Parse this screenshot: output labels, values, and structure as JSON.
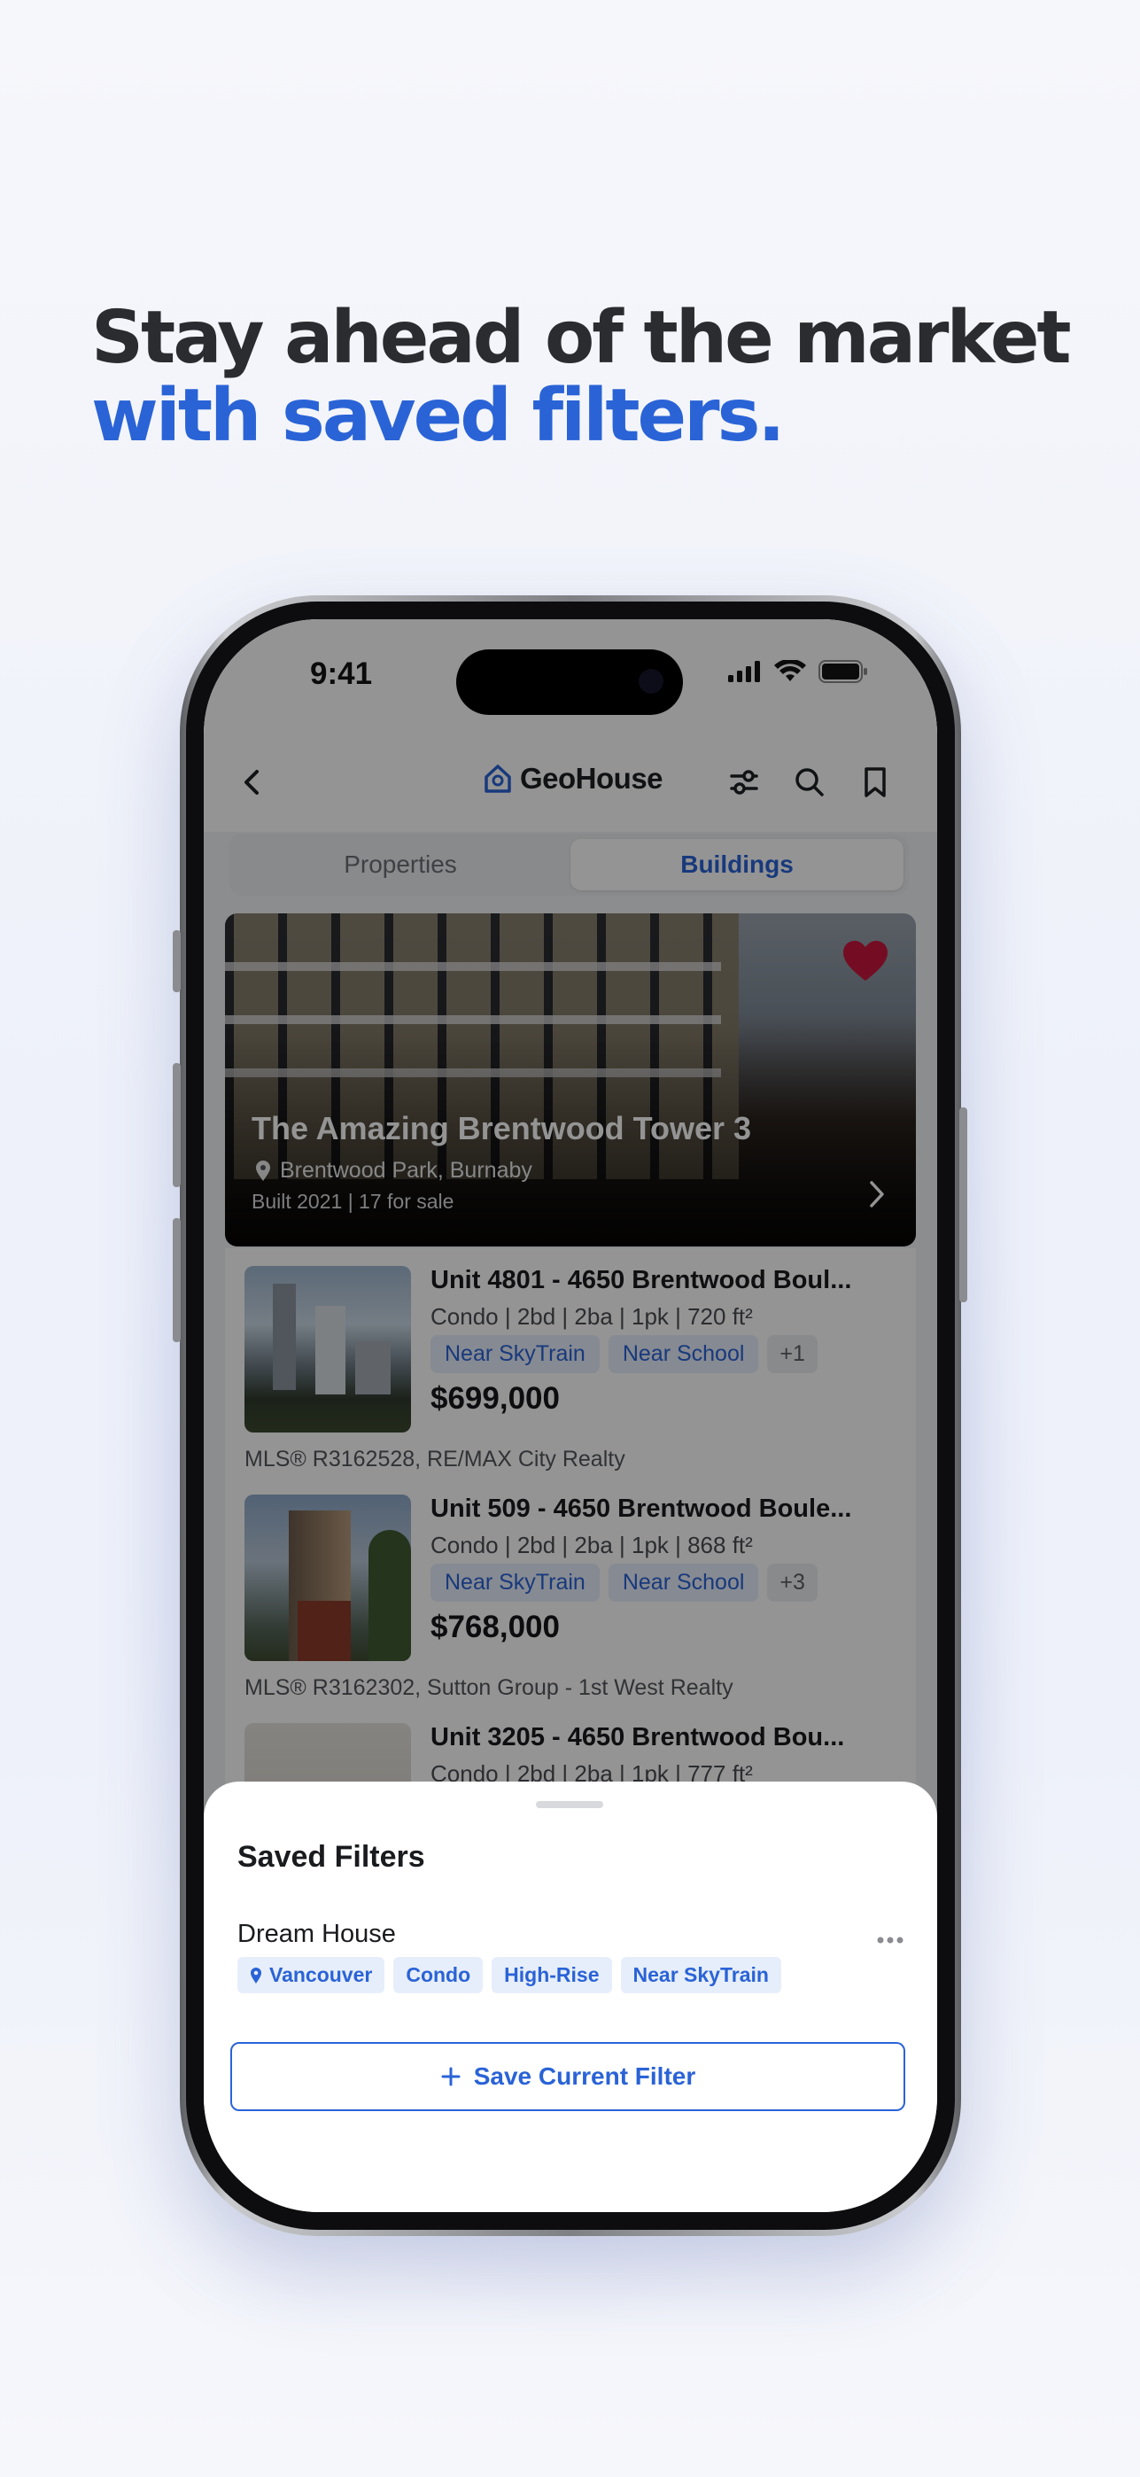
{
  "headline": {
    "line1": "Stay ahead of the market",
    "line2": "with saved filters."
  },
  "status_bar": {
    "time": "9:41"
  },
  "navbar": {
    "logo_text": "GeoHouse"
  },
  "tabs": [
    {
      "label": "Properties",
      "active": false
    },
    {
      "label": "Buildings",
      "active": true
    }
  ],
  "hero": {
    "title": "The Amazing Brentwood Tower 3",
    "location": "Brentwood Park, Burnaby",
    "meta": "Built 2021 | 17 for sale",
    "favorited": true
  },
  "listings": [
    {
      "title": "Unit 4801 - 4650 Brentwood Boul...",
      "details": "Condo | 2bd | 2ba | 1pk | 720 ft²",
      "tags": [
        "Near SkyTrain",
        "Near School"
      ],
      "more_tags": "+1",
      "price": "$699,000",
      "mls": "MLS® R3162528, RE/MAX City Realty"
    },
    {
      "title": "Unit 509 - 4650 Brentwood Boule...",
      "details": "Condo | 2bd | 2ba | 1pk | 868 ft²",
      "tags": [
        "Near SkyTrain",
        "Near School"
      ],
      "more_tags": "+3",
      "price": "$768,000",
      "mls": "MLS® R3162302, Sutton Group - 1st West Realty"
    },
    {
      "title": "Unit 3205 - 4650 Brentwood Bou...",
      "details": "Condo | 2bd | 2ba | 1pk | 777 ft²"
    }
  ],
  "sheet": {
    "title": "Saved Filters",
    "filters": [
      {
        "name": "Dream House",
        "chips": [
          "Vancouver",
          "Condo",
          "High-Rise",
          "Near SkyTrain"
        ]
      }
    ],
    "save_button_label": "Save Current Filter"
  },
  "colors": {
    "accent": "#2a63d6",
    "heart": "#c8173f",
    "headline_dark": "#2b2c30"
  },
  "icons": {
    "back": "chevron-left-icon",
    "filter": "sliders-icon",
    "search": "search-icon",
    "bookmark": "bookmark-icon",
    "favorite": "heart-icon",
    "location": "map-pin-icon",
    "more": "ellipsis-icon",
    "add": "plus-icon"
  }
}
